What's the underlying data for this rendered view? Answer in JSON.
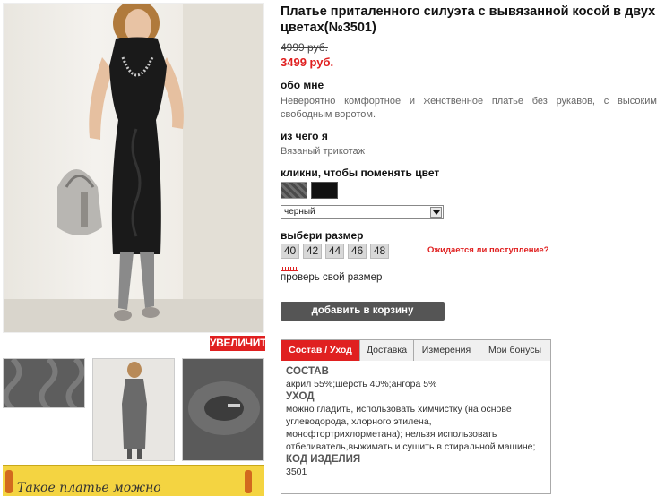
{
  "product": {
    "title": "Платье приталенного силуэта с вывязанной косой в двух цветах(№3501)",
    "old_price": "4999 руб.",
    "new_price": "3499 руб."
  },
  "about": {
    "heading": "обо мне",
    "text": "Невероятно комфортное и женственное платье без рукавов, с высоким свободным воротом."
  },
  "material": {
    "heading": "из чего я",
    "text": "Вязаный трикотаж"
  },
  "color": {
    "heading": "кликни, чтобы поменять цвет",
    "selected": "черный"
  },
  "size": {
    "heading": "выбери размер",
    "options": [
      "40",
      "42",
      "44",
      "46",
      "48"
    ],
    "notify_link": "Ожидается ли поступление?",
    "check_link": "проверь свой размер"
  },
  "cart_button": "добавить в корзину",
  "zoom_button": "УВЕЛИЧИТЬ",
  "banner_text": "Такое платье можно",
  "tabs": {
    "items": [
      "Состав / Уход",
      "Доставка",
      "Измерения",
      "Мои бонусы"
    ],
    "content": {
      "composition_heading": "СОСТАВ",
      "composition": "акрил 55%;шерсть 40%;ангора 5%",
      "care_heading": "УХОД",
      "care": "можно гладить, использовать химчистку (на основе углеводорода, хлорного этилена, монофтортрихлорметана); нельзя использовать отбеливатель,выжимать и сушить в стиральной машине;",
      "code_heading": "КОД ИЗДЕЛИЯ",
      "code": "3501"
    }
  },
  "colors": {
    "accent": "#e02020",
    "button_dark": "#555555",
    "banner": "#f4d441"
  }
}
